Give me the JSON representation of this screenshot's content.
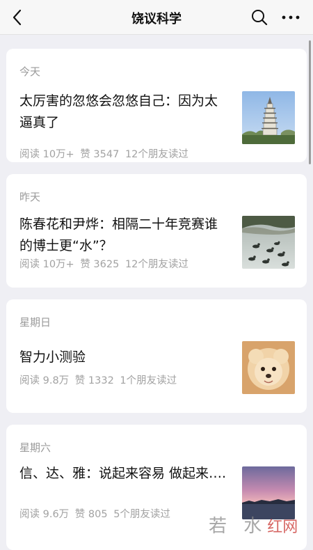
{
  "nav": {
    "title": "饶议科学"
  },
  "articles": [
    {
      "date": "今天",
      "title": "太厉害的忽悠会忽悠自己：因为太逼真了",
      "reads": "阅读 10万+",
      "likes": "赞 3547",
      "friends": "12个朋友读过",
      "thumb": "pagoda"
    },
    {
      "date": "昨天",
      "title": "陈春花和尹烨：相隔二十年竞赛谁的博士更“水”？",
      "reads": "阅读 10万+",
      "likes": "赞 3625",
      "friends": "12个朋友读过",
      "thumb": "ducks-lake"
    },
    {
      "date": "星期日",
      "title": "智力小测验",
      "reads": "阅读 9.8万",
      "likes": "赞 1332",
      "friends": "1个朋友读过",
      "thumb": "fluffy-dog"
    },
    {
      "date": "星期六",
      "title": "信、达、雅：说起来容易 做起来….",
      "reads": "阅读 9.6万",
      "likes": "赞 805",
      "friends": "5个朋友读过",
      "thumb": "sunset-sky"
    }
  ],
  "watermark": {
    "text": "若 水",
    "logo_text": "红网"
  },
  "colors": {
    "background": "#efeff4",
    "card": "#ffffff",
    "secondary_text": "#a2a2a2"
  }
}
